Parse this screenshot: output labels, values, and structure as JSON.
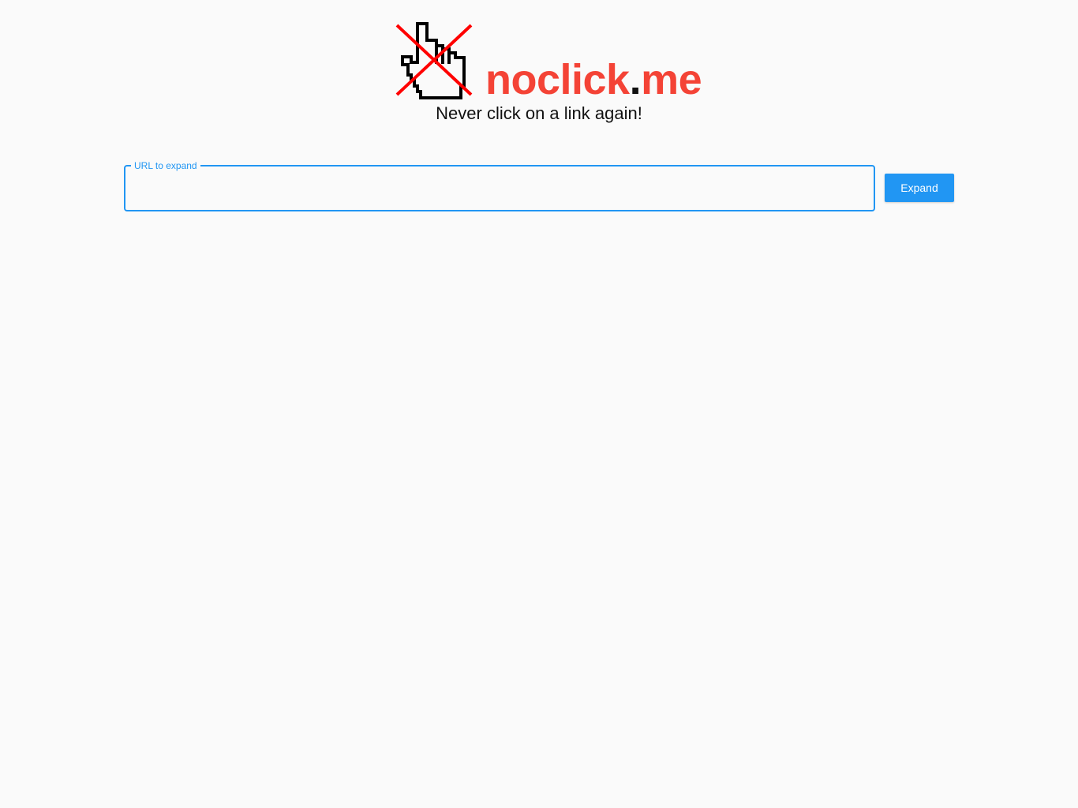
{
  "header": {
    "logo_icon": "crossed-out-pointing-hand-cursor-icon",
    "brand_name": "noclick",
    "brand_dot": ".",
    "brand_tld": "me",
    "tagline": "Never click on a link again!"
  },
  "form": {
    "url_label": "URL to expand",
    "url_value": "",
    "expand_label": "Expand"
  },
  "colors": {
    "accent": "#2196f3",
    "brand": "#f44336",
    "background": "#fafafa"
  }
}
